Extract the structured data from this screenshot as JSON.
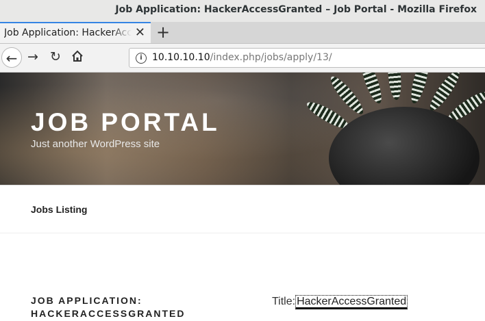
{
  "browser": {
    "window_title": "Job Application: HackerAccessGranted – Job Portal - Mozilla Firefox",
    "tab_label": "Job Application: HackerAccessGranted – Job Portal",
    "tab_close": "✕",
    "new_tab": "+",
    "url_host": "10.10.10.10",
    "url_path": "/index.php/jobs/apply/13/",
    "accent_color": "#3584e4"
  },
  "site": {
    "title": "JOB PORTAL",
    "tagline": "Just another WordPress site"
  },
  "menu": {
    "items": [
      {
        "label": "Jobs Listing"
      }
    ]
  },
  "content": {
    "entry_title": "Job Application: HackerAccessGranted",
    "field_label": "Title:",
    "field_value": "HackerAccessGranted"
  }
}
